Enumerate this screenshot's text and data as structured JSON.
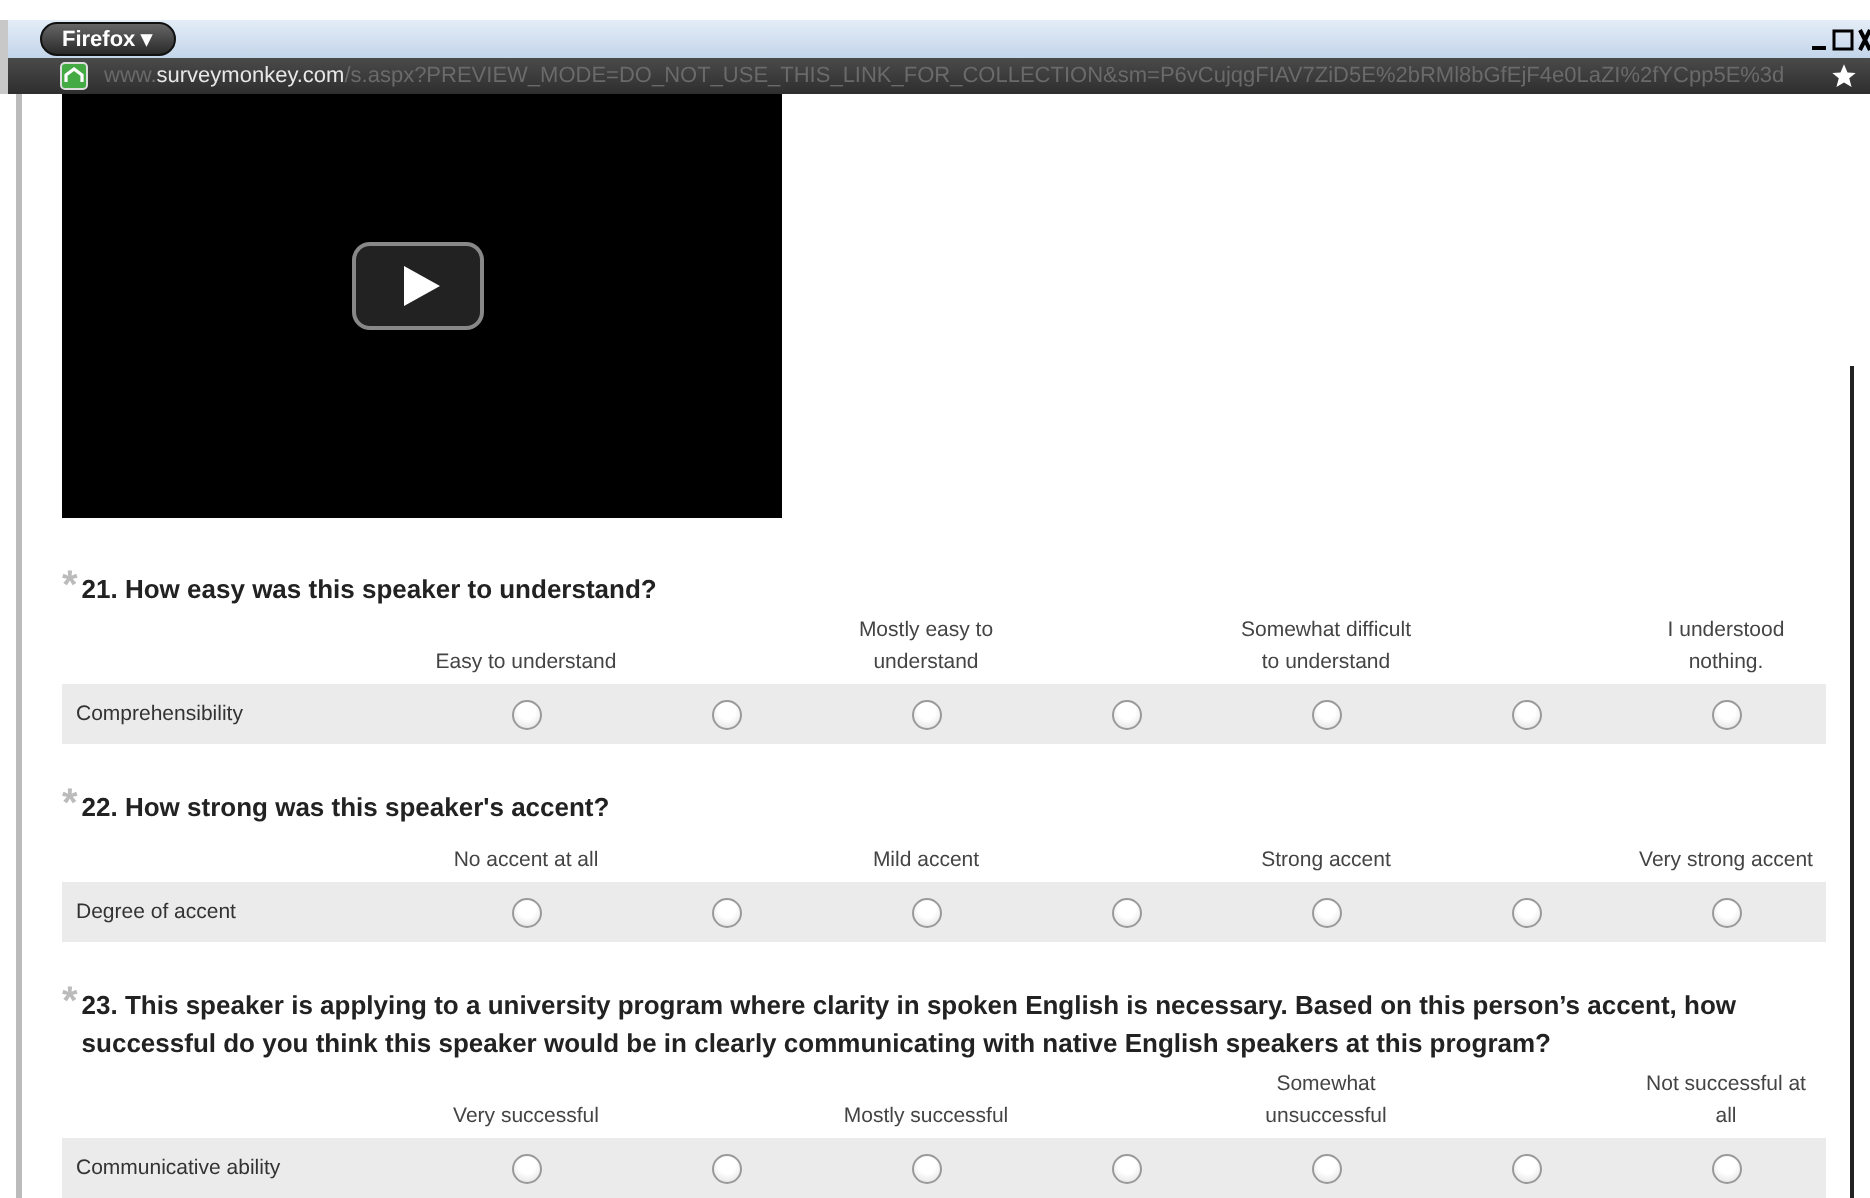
{
  "browser": {
    "menu_button": "Firefox ▾",
    "url_prefix": "www.",
    "url_domain": "surveymonkey.com",
    "url_path": "/s.aspx?PREVIEW_MODE=DO_NOT_USE_THIS_LINK_FOR_COLLECTION&sm=P6vCujqgFIAV7ZiD5E%2bRMl8bGfEjF4e0LaZI%2fYCpp5E%3d"
  },
  "questions": [
    {
      "marker": "*",
      "title": "21. How easy was this speaker to understand?",
      "scale_labels": [
        "Easy to understand",
        "Mostly easy to understand",
        "Somewhat difficult to understand",
        "I understood nothing."
      ],
      "rows": [
        {
          "label": "Comprehensibility",
          "options": [
            {
              "selected": false
            },
            {
              "selected": false
            },
            {
              "selected": false
            },
            {
              "selected": false
            },
            {
              "selected": false
            },
            {
              "selected": false
            },
            {
              "selected": false
            }
          ]
        }
      ]
    },
    {
      "marker": "*",
      "title": "22. How strong was this speaker's accent?",
      "scale_labels": [
        "No accent at all",
        "Mild accent",
        "Strong accent",
        "Very strong accent"
      ],
      "rows": [
        {
          "label": "Degree of accent",
          "options": [
            {
              "selected": false
            },
            {
              "selected": false
            },
            {
              "selected": false
            },
            {
              "selected": false
            },
            {
              "selected": false
            },
            {
              "selected": false
            },
            {
              "selected": false
            }
          ]
        }
      ]
    },
    {
      "marker": "*",
      "title": "23. This speaker is applying to a university program where clarity in spoken English is necessary. Based on this person’s accent, how successful do you think this speaker would be in clearly communicating with native English speakers at this program?",
      "scale_labels": [
        "Very successful",
        "Mostly successful",
        "Somewhat unsuccessful",
        "Not successful at all"
      ],
      "rows": [
        {
          "label": "Communicative ability",
          "options": [
            {
              "selected": false
            },
            {
              "selected": false
            },
            {
              "selected": false
            },
            {
              "selected": false
            },
            {
              "selected": false
            },
            {
              "selected": false
            },
            {
              "selected": false
            }
          ]
        }
      ]
    }
  ]
}
